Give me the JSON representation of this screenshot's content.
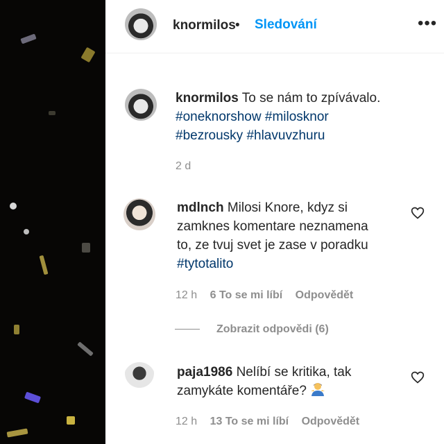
{
  "post": {
    "author": "knormilos",
    "separator": "•",
    "follow_label": "Sledování",
    "more_label": "•••",
    "caption": {
      "username": "knormilos",
      "text": "To se nám to zpívávalo.",
      "hashtags": [
        "#oneknorshow",
        "#milosknor",
        "#bezrousky",
        "#hlavuvzhuru"
      ],
      "time": "2 d"
    }
  },
  "comments": [
    {
      "username": "mdlnch",
      "text_line1": "Milosi Knore, kdyz si",
      "text_line2": "zamknes komentare neznamena",
      "text_line3": "to, ze tvuj svet je zase v poradku",
      "hashtag": "#tytotalito",
      "time": "12 h",
      "likes": "6 To se mi líbí",
      "reply_label": "Odpovědět",
      "view_replies": "Zobrazit odpovědi (6)"
    },
    {
      "username": "paja1986",
      "text_line1": "Nelíbí se kritika, tak",
      "text_line2": "zamykáte komentáře?",
      "emoji": "person-shrugging-emoji",
      "time": "12 h",
      "likes": "13 To se mi líbí",
      "reply_label": "Odpovědět"
    }
  ],
  "colors": {
    "link": "#0095f6",
    "hashtag": "#00376b",
    "muted": "#8e8e8e",
    "text": "#262626"
  }
}
